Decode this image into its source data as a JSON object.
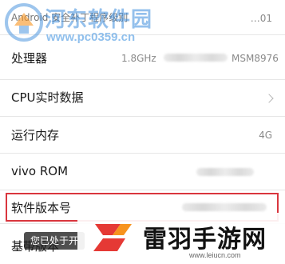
{
  "rows": [
    {
      "label": "Android 安全补丁程序级别",
      "value": "…01"
    },
    {
      "label": "处理器",
      "value_left": "1.8GHz",
      "value_right": "MSM8976"
    },
    {
      "label": "CPU实时数据"
    },
    {
      "label": "运行内存",
      "value": "4G"
    },
    {
      "label": "vivo ROM"
    },
    {
      "label": "软件版本号"
    },
    {
      "label": "基带版本"
    }
  ],
  "toast": "您已处于开",
  "watermark_top": {
    "title": "河东软件园",
    "url": "www.pc0359.cn"
  },
  "watermark_bottom": {
    "title": "雷羽手游网",
    "url": "www.leiucn.com"
  },
  "colors": {
    "highlight": "#d9363e",
    "watermark_blue": "#3c8cdc",
    "logo_red": "#e53935",
    "logo_orange": "#f7931e"
  },
  "icons": [
    "chevron-right-icon",
    "pc0359-logo-icon",
    "leiyu-logo-icon"
  ]
}
